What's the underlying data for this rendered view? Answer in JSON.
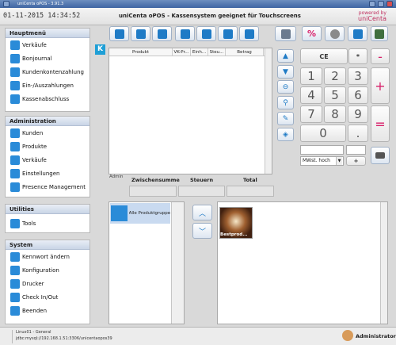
{
  "window": {
    "title": "uniCenta oPOS - 3.91.3"
  },
  "header": {
    "datetime": "01-11-2015 14:34:52",
    "app_title": "uniCenta oPOS - Kassensystem geeignet für Touchscreens",
    "logo_line1": "powered by",
    "logo_line2": "uniCenta"
  },
  "sidebar": {
    "sections": [
      {
        "title": "Hauptmenü",
        "items": [
          {
            "label": "Verkäufe",
            "icon": "cart-icon"
          },
          {
            "label": "Bonjournal",
            "icon": "cart-list-icon"
          },
          {
            "label": "Kundenkontenzahlung",
            "icon": "people-icon"
          },
          {
            "label": "Ein-/Auszahlungen",
            "icon": "cash-transfer-icon"
          },
          {
            "label": "Kassenabschluss",
            "icon": "calculator-icon"
          }
        ]
      },
      {
        "title": "Administration",
        "items": [
          {
            "label": "Kunden",
            "icon": "customers-icon"
          },
          {
            "label": "Produkte",
            "icon": "box-icon"
          },
          {
            "label": "Verkäufe",
            "icon": "sales-cart-icon"
          },
          {
            "label": "Einstellungen",
            "icon": "settings-gears-icon"
          },
          {
            "label": "Presence Management",
            "icon": "presence-users-icon"
          }
        ]
      },
      {
        "title": "Utilities",
        "items": [
          {
            "label": "Tools",
            "icon": "tools-icon"
          }
        ]
      },
      {
        "title": "System",
        "items": [
          {
            "label": "Kennwort ändern",
            "icon": "key-icon"
          },
          {
            "label": "Konfiguration",
            "icon": "config-gear-icon"
          },
          {
            "label": "Drucker",
            "icon": "printer-icon"
          },
          {
            "label": "Check In/Out",
            "icon": "clock-icon"
          },
          {
            "label": "Beenden",
            "icon": "exit-arrow-icon"
          }
        ]
      }
    ]
  },
  "ticket": {
    "columns": [
      "Produkt",
      "VK-Pr...",
      "Einh...",
      "Steu...",
      "Betrag"
    ],
    "admin_label": "Admin",
    "totals_labels": [
      "Zwischensumme",
      "Steuern",
      "Total"
    ]
  },
  "keypad": {
    "ce": "CE",
    "star": "*",
    "minus": "-",
    "plus": "+",
    "equals": "=",
    "digits": [
      "1",
      "2",
      "3",
      "4",
      "5",
      "6",
      "7",
      "8",
      "9",
      "0",
      "."
    ],
    "tax_select": "MWst. hoch",
    "small_plus": "+"
  },
  "categories": {
    "item": "Alle Produktgruppen"
  },
  "products": {
    "item": "Bestprod..."
  },
  "statusbar": {
    "line1": "Linux01 - General",
    "line2": "jdbc:mysql://192.168.1.51:3306/unicentaopos39",
    "user": "Administrator"
  },
  "colors": {
    "accent_blue": "#1f7bc6",
    "brand_pink": "#d8206a",
    "header_blue": "#3f66a3"
  }
}
